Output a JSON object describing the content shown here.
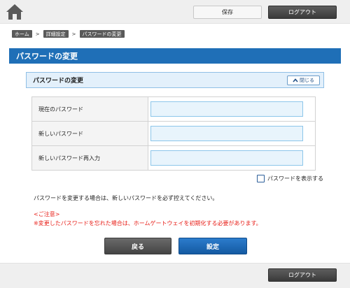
{
  "topbar": {
    "home_icon": "home-icon",
    "save_label": "保存",
    "logout_label": "ログアウト"
  },
  "breadcrumb": {
    "items": [
      "ホーム",
      "詳細設定",
      "パスワードの変更"
    ],
    "separator": ">"
  },
  "page": {
    "title": "パスワードの変更"
  },
  "section": {
    "title": "パスワードの変更",
    "collapse_label": "閉じる",
    "collapse_icon": "chevron-up-icon"
  },
  "form": {
    "rows": [
      {
        "label": "現在のパスワード",
        "value": ""
      },
      {
        "label": "新しいパスワード",
        "value": ""
      },
      {
        "label": "新しいパスワード再入力",
        "value": ""
      }
    ],
    "show_password_label": "パスワードを表示する",
    "show_password_checked": false
  },
  "notes": {
    "info": "パスワードを変更する場合は、新しいパスワードを必ず控えてください。",
    "caution_title": "<ご注意>",
    "caution_text": "※変更したパスワードを忘れた場合は、ホームゲートウェイを初期化する必要があります。"
  },
  "actions": {
    "back_label": "戻る",
    "set_label": "設定"
  },
  "footer": {
    "logout_label": "ログアウト"
  },
  "colors": {
    "title_bar": "#1f6fb7",
    "section_bg": "#e3f0fb",
    "input_bg": "#e8f4fc",
    "caution": "#e8201a",
    "primary_button": "#1f6fb7",
    "dark_button": "#444444"
  }
}
